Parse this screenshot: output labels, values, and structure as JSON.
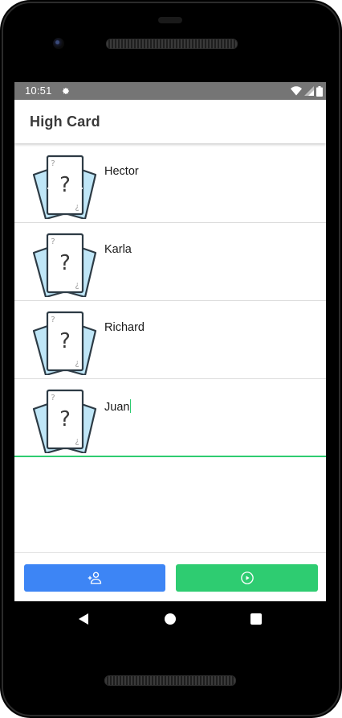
{
  "status_bar": {
    "time": "10:51",
    "icons": [
      "gear-icon",
      "wifi-icon",
      "signal-icon",
      "battery-icon"
    ]
  },
  "app_bar": {
    "title": "High Card"
  },
  "players": [
    {
      "name": "Hector"
    },
    {
      "name": "Karla"
    },
    {
      "name": "Richard"
    },
    {
      "name": "Juan"
    }
  ],
  "actions": {
    "add_player_icon": "add-person-icon",
    "play_icon": "play-circle-icon"
  },
  "colors": {
    "status_bar": "#757575",
    "add_button": "#3d85f5",
    "play_button": "#2ecc71",
    "active_underline": "#2ecc71",
    "card_back": "#bfe6f7"
  },
  "nav": [
    "back-icon",
    "home-icon",
    "recents-icon"
  ]
}
